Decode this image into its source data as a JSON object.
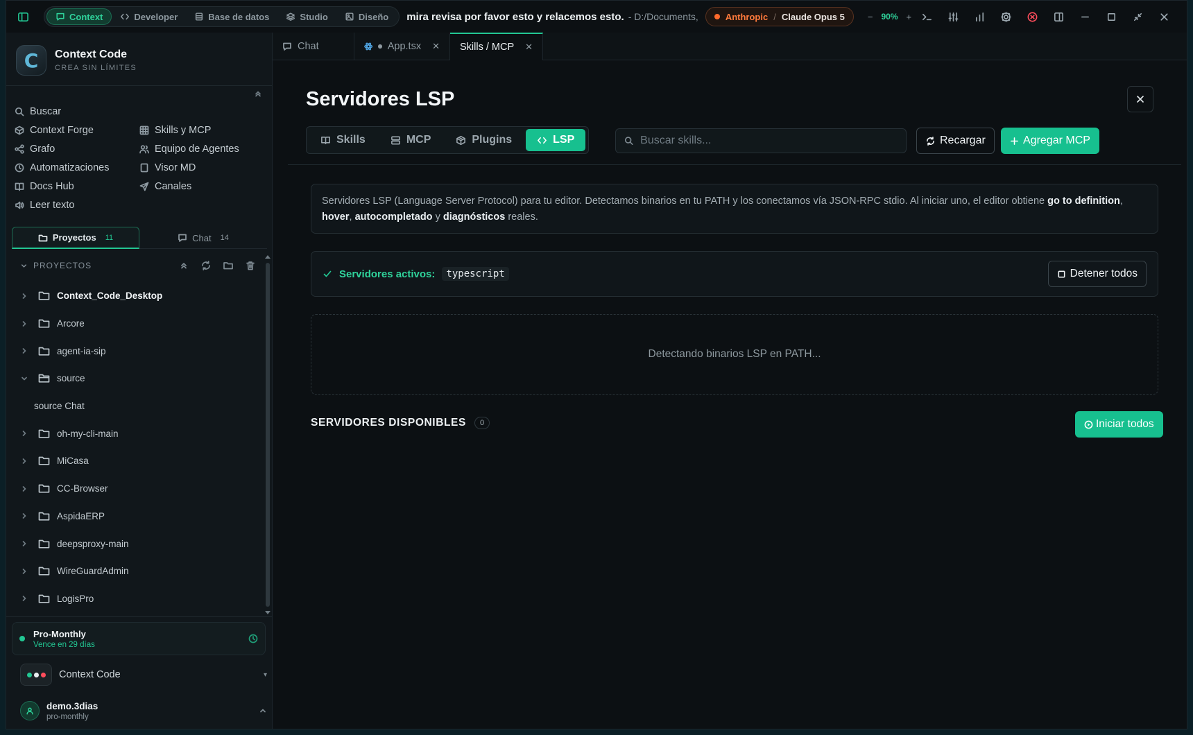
{
  "titlebar": {
    "modes": [
      {
        "label": "Context",
        "icon": "chat-bubble-icon",
        "active": true
      },
      {
        "label": "Developer",
        "icon": "code-icon",
        "active": false
      },
      {
        "label": "Base de datos",
        "icon": "database-icon",
        "active": false
      },
      {
        "label": "Studio",
        "icon": "layers-icon",
        "active": false
      },
      {
        "label": "Diseño",
        "icon": "image-icon",
        "active": false
      }
    ],
    "title": "mira revisa por favor esto y relacemos esto.",
    "path": "- D:/Documents,",
    "model": {
      "provider": "Anthropic",
      "separator": "/",
      "name": "Claude Opus 5"
    },
    "zoom": {
      "minus": "−",
      "value": "90%",
      "plus": "+"
    }
  },
  "sidebar": {
    "brand": {
      "logo_letter": "C",
      "name": "Context Code",
      "tagline": "CREA SIN LÍMITES"
    },
    "nav_left": [
      {
        "label": "Buscar",
        "icon": "search-icon"
      },
      {
        "label": "Context Forge",
        "icon": "cube-icon"
      },
      {
        "label": "Grafo",
        "icon": "share-graph-icon"
      },
      {
        "label": "Automatizaciones",
        "icon": "clock-icon"
      },
      {
        "label": "Docs Hub",
        "icon": "book-icon"
      },
      {
        "label": "Leer texto",
        "icon": "speaker-icon"
      }
    ],
    "nav_right": [
      {
        "label": "Skills y MCP",
        "icon": "grid-icon"
      },
      {
        "label": "Equipo de Agentes",
        "icon": "users-icon"
      },
      {
        "label": "Visor MD",
        "icon": "file-icon"
      },
      {
        "label": "Canales",
        "icon": "send-icon"
      }
    ],
    "tabs": {
      "projects": {
        "label": "Proyectos",
        "count": "11"
      },
      "chat": {
        "label": "Chat",
        "count": "14"
      }
    },
    "projects_header": "PROYECTOS",
    "projects": [
      {
        "name": "Context_Code_Desktop",
        "bold": true,
        "expanded": false
      },
      {
        "name": "Arcore",
        "expanded": false
      },
      {
        "name": "agent-ia-sip",
        "expanded": false
      },
      {
        "name": "source",
        "expanded": true
      },
      {
        "name": "source Chat",
        "child": true
      },
      {
        "name": "oh-my-cli-main",
        "expanded": false
      },
      {
        "name": "MiCasa",
        "expanded": false
      },
      {
        "name": "CC-Browser",
        "expanded": false
      },
      {
        "name": "AspidaERP",
        "expanded": false
      },
      {
        "name": "deepsproxy-main",
        "expanded": false
      },
      {
        "name": "WireGuardAdmin",
        "expanded": false
      },
      {
        "name": "LogisPro",
        "expanded": false
      }
    ],
    "plan": {
      "name": "Pro-Monthly",
      "expiry": "Vence en 29 días"
    },
    "workspace": {
      "name": "Context Code",
      "caret": "▾"
    },
    "user": {
      "name": "demo.3dias",
      "plan": "pro-monthly"
    }
  },
  "editor_tabs": [
    {
      "label": "Chat",
      "icon": "chat-bubble-icon",
      "active": false,
      "closable": false
    },
    {
      "label": "App.tsx",
      "icon": "react-icon",
      "active": false,
      "closable": true,
      "modified": true
    },
    {
      "label": "Skills / MCP",
      "active": true,
      "closable": true
    }
  ],
  "main": {
    "title": "Servidores LSP",
    "segments": [
      {
        "label": "Skills",
        "icon": "book-open-icon",
        "active": false
      },
      {
        "label": "MCP",
        "icon": "server-icon",
        "active": false
      },
      {
        "label": "Plugins",
        "icon": "package-icon",
        "active": false
      },
      {
        "label": "LSP",
        "icon": "code-icon",
        "active": true
      }
    ],
    "search_placeholder": "Buscar skills...",
    "reload_label": "Recargar",
    "add_label": "Agregar MCP",
    "info": {
      "part1": "Servidores LSP (Language Server Protocol) para tu editor. Detectamos binarios en tu PATH y los conectamos vía JSON-RPC stdio. Al iniciar uno, el editor obtiene ",
      "b1": "go to definition",
      "sep1": ", ",
      "b2": "hover",
      "sep2": ", ",
      "b3": "autocompletado",
      "sep3": " y ",
      "b4": "diagnósticos",
      "part2": " reales."
    },
    "active_servers_label": "Servidores activos:",
    "active_servers_value": "typescript",
    "stop_all_label": "Detener todos",
    "detecting_text": "Detectando binarios LSP en PATH...",
    "available_title": "SERVIDORES DISPONIBLES",
    "available_count": "0",
    "start_all_label": "Iniciar todos"
  },
  "colors": {
    "accent": "#17c08f",
    "accent_text": "#2fd39b",
    "provider": "#ff7a3c",
    "danger": "#ff4d5c"
  }
}
